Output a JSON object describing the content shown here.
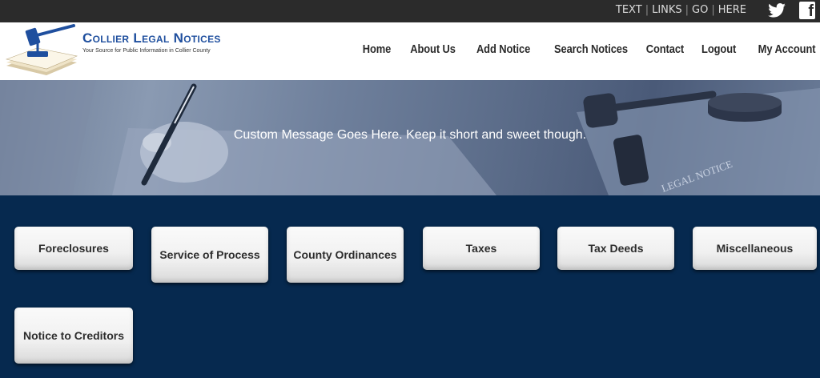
{
  "topbar": {
    "links": [
      "TEXT",
      "LINKS",
      "GO",
      "HERE"
    ],
    "social": [
      "twitter-icon",
      "facebook-icon"
    ]
  },
  "brand": {
    "title": "Collier Legal Notices",
    "tagline": "Your Source for Public Information in Collier County"
  },
  "nav": [
    "Home",
    "About Us",
    "Add Notice",
    "Search Notices",
    "Contact",
    "Logout",
    "My Account"
  ],
  "hero": {
    "message": "Custom Message Goes Here. Keep it short and sweet though.",
    "paper_text": "LEGAL NOTICE"
  },
  "categories": [
    "Foreclosures",
    "Service of Process",
    "County Ordinances",
    "Taxes",
    "Tax Deeds",
    "Miscellaneous",
    "Notice to Creditors"
  ],
  "colors": {
    "topbar": "#2b2b2b",
    "brand_blue": "#1f4f9e",
    "panel": "#06294f"
  }
}
